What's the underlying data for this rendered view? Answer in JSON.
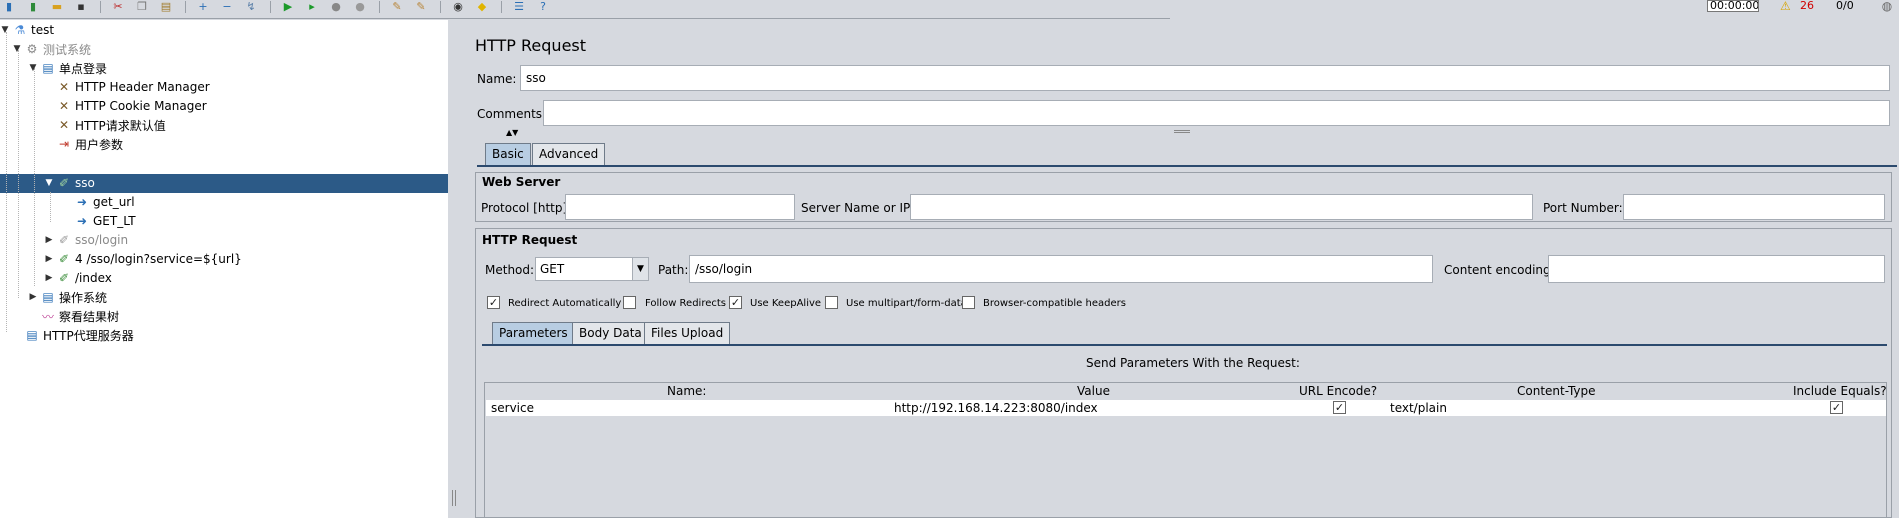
{
  "toolbar": {
    "icons": [
      "new-test-plan-icon",
      "open-templates-icon",
      "open-folder-icon",
      "save-icon",
      "cut-icon",
      "copy-icon",
      "paste-icon",
      "expand-icon",
      "collapse-icon",
      "toggle-icon",
      "start-icon",
      "start-no-pause-icon",
      "stop-icon",
      "shutdown-icon",
      "clear-icon",
      "clear-all-icon",
      "search-icon",
      "reset-search-icon",
      "function-helper-icon",
      "help-icon"
    ],
    "timer": "00:00:00",
    "error_count": "26",
    "threads": "0/0"
  },
  "tree": {
    "items": [
      {
        "label": "test",
        "icon": "test-plan-icon"
      },
      {
        "label": "测试系统",
        "icon": "thread-group-icon"
      },
      {
        "label": "单点登录",
        "icon": "controller-icon"
      },
      {
        "label": "HTTP Header Manager",
        "icon": "config-element-icon"
      },
      {
        "label": "HTTP Cookie Manager",
        "icon": "config-element-icon"
      },
      {
        "label": "HTTP请求默认值",
        "icon": "config-element-icon"
      },
      {
        "label": "用户参数",
        "icon": "preprocessor-icon"
      },
      {
        "label": "sso",
        "icon": "sampler-icon"
      },
      {
        "label": "get_url",
        "icon": "extractor-icon"
      },
      {
        "label": "GET_LT",
        "icon": "extractor-icon"
      },
      {
        "label": "sso/login",
        "icon": "sampler-icon"
      },
      {
        "label": "4 /sso/login?service=${url}",
        "icon": "sampler-icon"
      },
      {
        "label": "/index",
        "icon": "sampler-icon"
      },
      {
        "label": "操作系统",
        "icon": "controller-icon"
      },
      {
        "label": "察看结果树",
        "icon": "listener-icon"
      },
      {
        "label": "HTTP代理服务器",
        "icon": "workbench-icon"
      }
    ]
  },
  "panel": {
    "title": "HTTP Request",
    "name_label": "Name:",
    "name_value": "sso",
    "comments_label": "Comments:",
    "comments_value": "",
    "tabs": [
      "Basic",
      "Advanced"
    ],
    "web_server": {
      "title": "Web Server",
      "protocol_label": "Protocol [http]:",
      "protocol_value": "",
      "server_label": "Server Name or IP:",
      "server_value": "",
      "port_label": "Port Number:",
      "port_value": ""
    },
    "http_request": {
      "title": "HTTP Request",
      "method_label": "Method:",
      "method_value": "GET",
      "path_label": "Path:",
      "path_value": "/sso/login",
      "encoding_label": "Content encoding:",
      "encoding_value": "",
      "options": [
        {
          "label": "Redirect Automatically",
          "checked": true
        },
        {
          "label": "Follow Redirects",
          "checked": false
        },
        {
          "label": "Use KeepAlive",
          "checked": true
        },
        {
          "label": "Use multipart/form-data",
          "checked": false
        },
        {
          "label": "Browser-compatible headers",
          "checked": false
        }
      ]
    },
    "sub_tabs": [
      "Parameters",
      "Body Data",
      "Files Upload"
    ],
    "params_title": "Send Parameters With the Request:",
    "table": {
      "headers": [
        "Name:",
        "Value",
        "URL Encode?",
        "Content-Type",
        "Include Equals?"
      ],
      "rows": [
        {
          "name": "service",
          "value": "http://192.168.14.223:8080/index",
          "url_encode": true,
          "content_type": "text/plain",
          "include_equals": true
        }
      ]
    }
  }
}
